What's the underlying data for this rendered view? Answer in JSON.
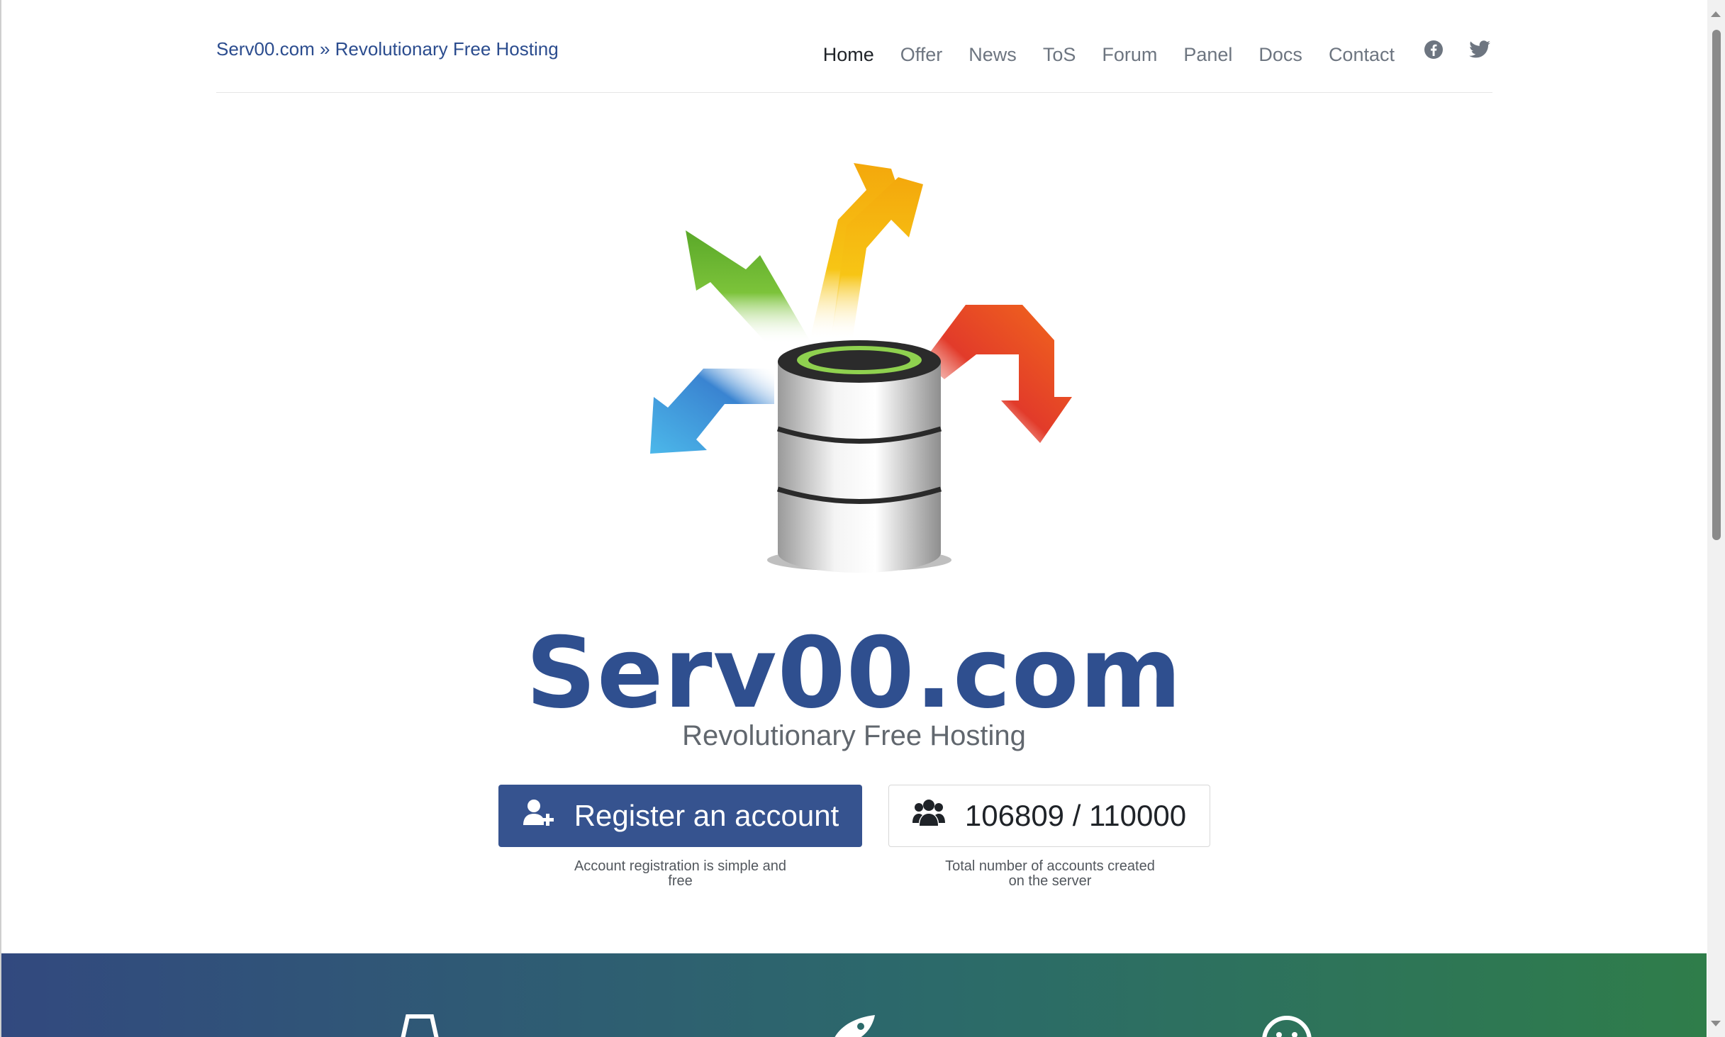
{
  "header": {
    "brand": "Serv00.com » Revolutionary Free Hosting",
    "nav": [
      "Home",
      "Offer",
      "News",
      "ToS",
      "Forum",
      "Panel",
      "Docs",
      "Contact"
    ],
    "active_nav": "Home",
    "social_icons": [
      "facebook-icon",
      "twitter-icon"
    ]
  },
  "hero": {
    "title": "Serv00.com",
    "subtitle": "Revolutionary Free Hosting",
    "register_button": "Register an account",
    "register_icon": "user-plus-icon",
    "register_caption": "Account registration is simple and free",
    "account_count": "106809 / 110000",
    "count_icon": "users-icon",
    "count_caption": "Total number of accounts created on the server"
  },
  "colors": {
    "brand_blue": "#36538f",
    "title_blue": "#2f4f8f",
    "band_start": "#32497f",
    "band_end": "#2f7d4a"
  },
  "band_icons": [
    "cup-icon",
    "rocket-icon",
    "smiley-icon"
  ]
}
